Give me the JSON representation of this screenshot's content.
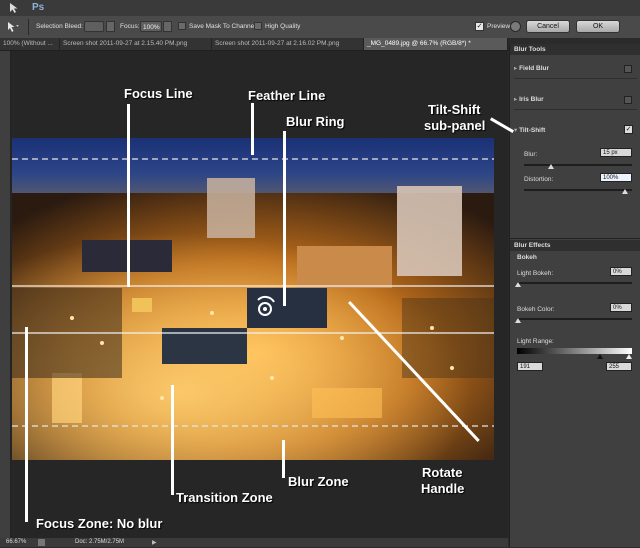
{
  "app": {
    "logo": "Ps"
  },
  "options_bar": {
    "selection_bleed_label": "Selection Bleed:",
    "focus_label": "Focus:",
    "focus_value": "100%",
    "save_mask_label": "Save Mask To Channels",
    "high_quality_label": "High Quality",
    "preview_label": "Preview",
    "cancel_label": "Cancel",
    "ok_label": "OK"
  },
  "tabs": [
    {
      "label": "100% (Without ..."
    },
    {
      "label": "Screen shot 2011-09-27 at 2.15.40 PM.png"
    },
    {
      "label": "Screen shot 2011-09-27 at 2.16.02 PM.png"
    },
    {
      "label": "_MG_0489.jpg @ 66.7% (RGB/8*) *"
    }
  ],
  "panel": {
    "blur_tools_title": "Blur Tools",
    "field_blur_label": "Field Blur",
    "iris_blur_label": "Iris Blur",
    "tilt_shift_label": "Tilt-Shift",
    "blur_label": "Blur:",
    "blur_value": "15 px",
    "distortion_label": "Distortion:",
    "distortion_value": "100%",
    "blur_effects_title": "Blur Effects",
    "bokeh_label": "Bokeh",
    "light_bokeh_label": "Light Bokeh:",
    "light_bokeh_value": "0%",
    "bokeh_color_label": "Bokeh Color:",
    "bokeh_color_value": "0%",
    "light_range_label": "Light Range:",
    "light_range_low": "191",
    "light_range_high": "255"
  },
  "status": {
    "zoom": "66.67%",
    "doc": "Doc: 2.75M/2.75M"
  },
  "annotations": {
    "focus_line": "Focus Line",
    "feather_line": "Feather Line",
    "blur_ring": "Blur Ring",
    "tilt_shift_subpanel_1": "Tilt-Shift",
    "tilt_shift_subpanel_2": "sub-panel",
    "rotate_handle_1": "Rotate",
    "rotate_handle_2": "Handle",
    "transition_zone": "Transition Zone",
    "blur_zone": "Blur Zone",
    "focus_zone": "Focus Zone: No blur"
  },
  "colors": {
    "sky": "#1b2f6e",
    "city_glow": "#e89a2a",
    "panel_bg": "#404040"
  }
}
